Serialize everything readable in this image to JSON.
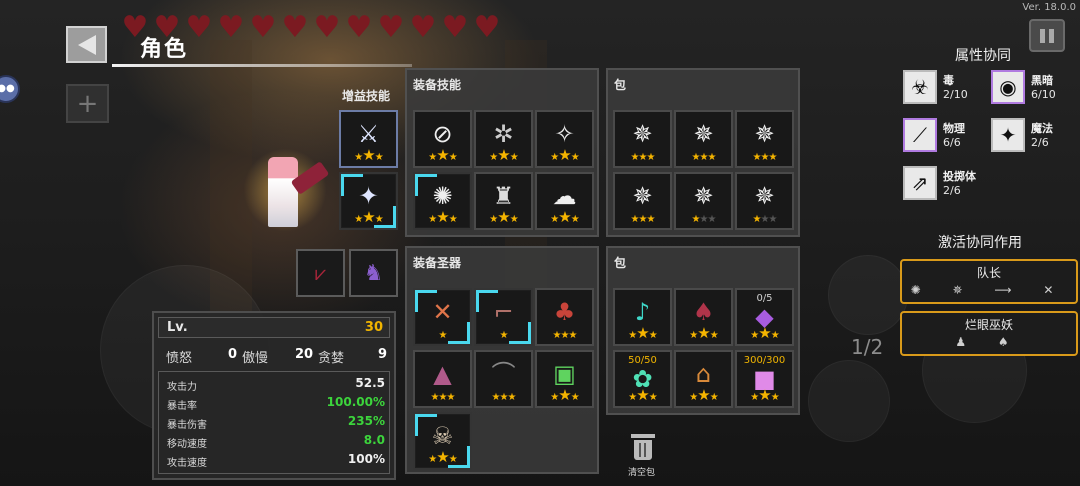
{
  "version": "Ver. 18.0.0",
  "header": {
    "title": "角色",
    "hearts": 12,
    "heart_color": "#7b1a21"
  },
  "labels": {
    "buff_skills": "增益技能",
    "equip_skills": "装备技能",
    "bag_top": "包",
    "equip_relics": "装备圣器",
    "bag_bottom": "包",
    "clear_bag": "清空包",
    "attribute_synergy": "属性协同",
    "active_synergy": "激活协同作用",
    "pager": "1/2"
  },
  "stats": {
    "level_label": "Lv.",
    "level": "30",
    "virtues": [
      {
        "name": "愤怒",
        "value": "0"
      },
      {
        "name": "傲慢",
        "value": "20"
      },
      {
        "name": "贪婪",
        "value": "9"
      }
    ],
    "rows": [
      {
        "label": "攻击力",
        "value": "52.5",
        "green": false
      },
      {
        "label": "暴击率",
        "value": "100.00%",
        "green": true
      },
      {
        "label": "暴击伤害",
        "value": "235%",
        "green": true
      },
      {
        "label": "移动速度",
        "value": "8.0",
        "green": true
      },
      {
        "label": "攻击速度",
        "value": "100%",
        "green": false
      }
    ]
  },
  "synergies": [
    {
      "name": "毒",
      "count": "2/10",
      "icon": "biohazard-icon"
    },
    {
      "name": "黑暗",
      "count": "6/10",
      "icon": "dark-orb-icon"
    },
    {
      "name": "物理",
      "count": "6/6",
      "icon": "sword-icon"
    },
    {
      "name": "魔法",
      "count": "2/6",
      "icon": "magic-star-icon"
    },
    {
      "name": "投掷体",
      "count": "2/6",
      "icon": "projectile-icon"
    }
  ],
  "active": [
    {
      "name": "队长",
      "icons": "✺ ✵ ⟶ ✕"
    },
    {
      "name": "烂眼巫妖",
      "icons": "♟ ♠"
    }
  ],
  "slot_counts": {
    "c1": "0/5",
    "c2": "50/50",
    "c3": "300/300"
  },
  "colors": {
    "accent": "#4ad8ee",
    "star": "#f4b400",
    "gold_border": "#d99a1a",
    "green": "#3cd43c"
  }
}
